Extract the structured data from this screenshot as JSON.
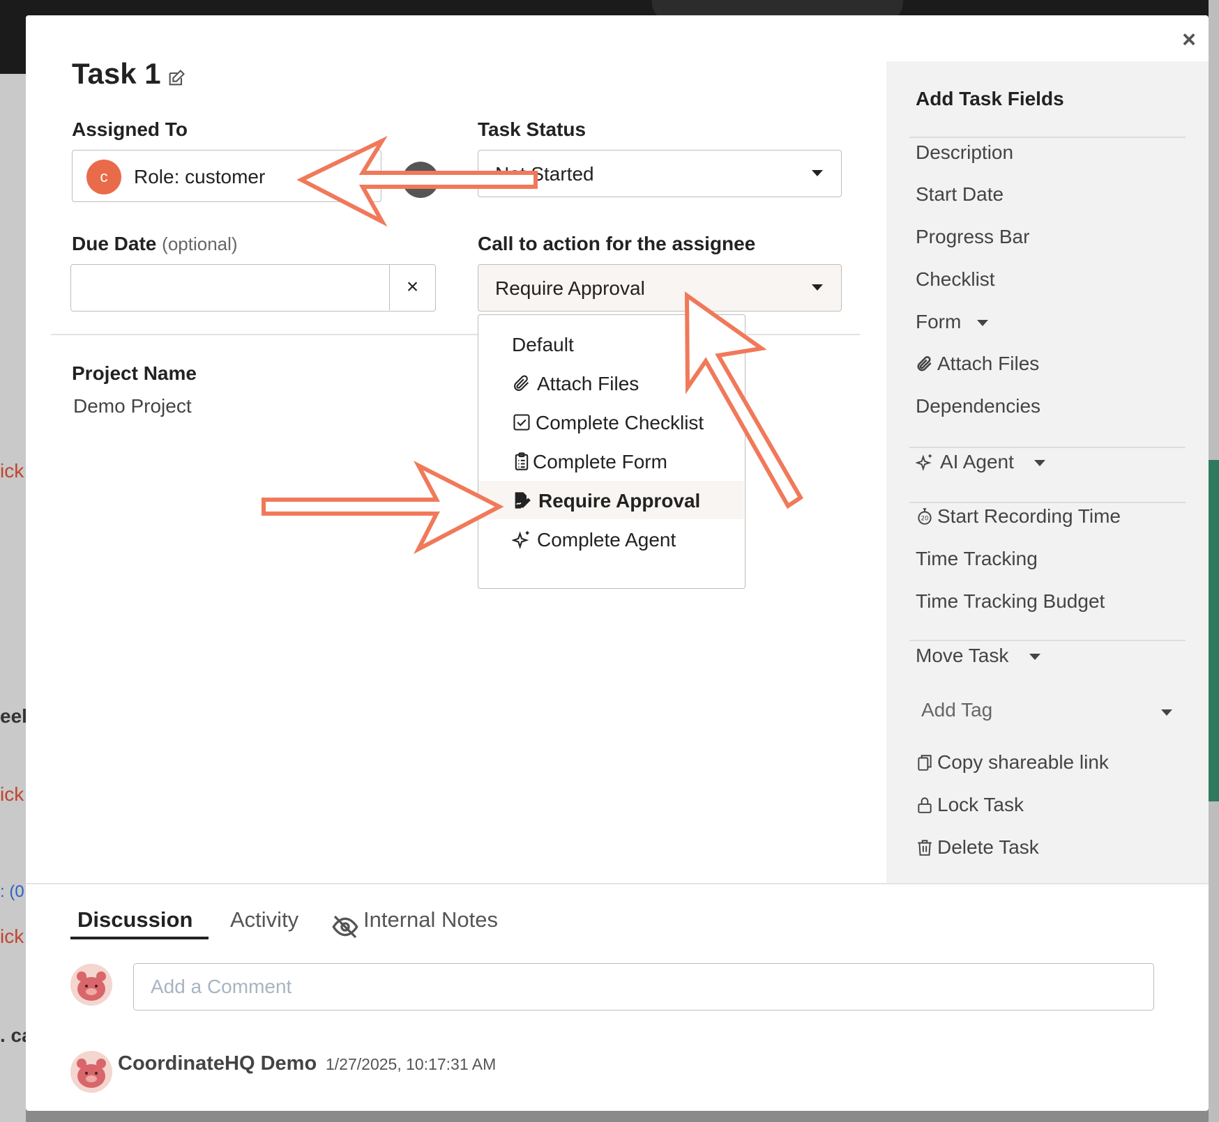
{
  "modal": {
    "title": "Task 1",
    "close_label": "×"
  },
  "assigned_to": {
    "label": "Assigned To",
    "avatar_letter": "c",
    "value": "Role: customer"
  },
  "task_status": {
    "label": "Task Status",
    "value": "Not Started"
  },
  "due_date": {
    "label": "Due Date",
    "optional": "(optional)",
    "value": "",
    "clear_label": "×"
  },
  "cta": {
    "label": "Call to action for the assignee",
    "value": "Require Approval",
    "options": [
      {
        "label": "Default",
        "icon": ""
      },
      {
        "label": "Attach Files",
        "icon": "paperclip-icon"
      },
      {
        "label": "Complete Checklist",
        "icon": "checkbox-icon"
      },
      {
        "label": "Complete Form",
        "icon": "clipboard-icon"
      },
      {
        "label": "Require Approval",
        "icon": "approval-icon"
      },
      {
        "label": "Complete Agent",
        "icon": "sparkle-icon"
      }
    ]
  },
  "project": {
    "label": "Project Name",
    "value": "Demo Project"
  },
  "sidebar": {
    "title": "Add Task Fields",
    "items": [
      {
        "label": "Description"
      },
      {
        "label": "Start Date"
      },
      {
        "label": "Progress Bar"
      },
      {
        "label": "Checklist"
      },
      {
        "label": "Form"
      },
      {
        "label": "Attach Files"
      },
      {
        "label": "Dependencies"
      },
      {
        "label": "AI Agent"
      },
      {
        "label": "Start Recording Time"
      },
      {
        "label": "Time Tracking"
      },
      {
        "label": "Time Tracking Budget"
      },
      {
        "label": "Move Task"
      },
      {
        "label": "Add Tag"
      },
      {
        "label": "Copy shareable link"
      },
      {
        "label": "Lock Task"
      },
      {
        "label": "Delete Task"
      }
    ]
  },
  "tabs": [
    {
      "label": "Discussion",
      "active": true
    },
    {
      "label": "Activity",
      "active": false
    },
    {
      "label": "Internal Notes",
      "active": false
    }
  ],
  "comment": {
    "placeholder": "Add a Comment"
  },
  "post": {
    "author": "CoordinateHQ Demo",
    "timestamp": "1/27/2025, 10:17:31 AM"
  },
  "background_fragments": [
    "ick",
    "eek",
    "ick",
    ": (0",
    "ick",
    ". ca"
  ],
  "colors": {
    "accent": "#e96b4a",
    "arrow": "#f0795a",
    "sidebar_bg": "#f2f2f2"
  }
}
